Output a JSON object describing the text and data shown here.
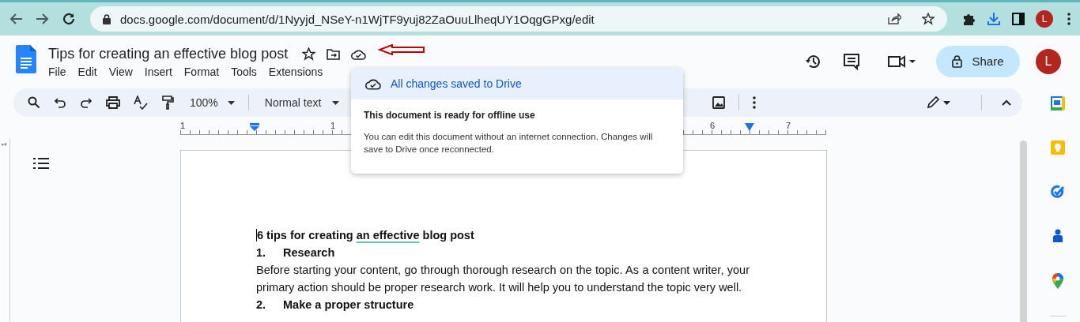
{
  "browser": {
    "url": "docs.google.com/document/d/1Nyyjd_NSeY-n1WjTF9yuj82ZaOuuLlheqUY1OqgGPxg/edit",
    "profile_letter": "L"
  },
  "doc_header": {
    "title": "Tips for creating an effective blog post",
    "starred": false,
    "menu": [
      "File",
      "Edit",
      "View",
      "Insert",
      "Format",
      "Tools",
      "Extensions"
    ],
    "share_label": "Share",
    "account_letter": "L"
  },
  "toolbar": {
    "zoom": "100%",
    "style": "Normal text"
  },
  "ruler": {
    "labels": [
      {
        "text": "1"
      },
      {
        "text": "1"
      },
      {
        "text": "6"
      },
      {
        "text": "7"
      }
    ],
    "vertical_label": "1"
  },
  "save_popup": {
    "status": "All changes saved to Drive",
    "heading": "This document is ready for offline use",
    "body": "You can edit this document without an internet connection. Changes will save to Drive once reconnected."
  },
  "document": {
    "heading": [
      {
        "text": "6 tips for creating ",
        "flagged": false
      },
      {
        "text": "an effective",
        "flagged": true
      },
      {
        "text": " blog post",
        "flagged": false
      }
    ],
    "blocks": [
      {
        "kind": "list-heading",
        "number": "1.",
        "text": "Research"
      },
      {
        "kind": "paragraph",
        "text": "Before starting your content, go through thorough research on the topic. As a content writer, your primary action should be proper research work. It will help you to understand the topic very well."
      },
      {
        "kind": "list-heading",
        "number": "2.",
        "text": "Make a proper structure"
      }
    ]
  }
}
